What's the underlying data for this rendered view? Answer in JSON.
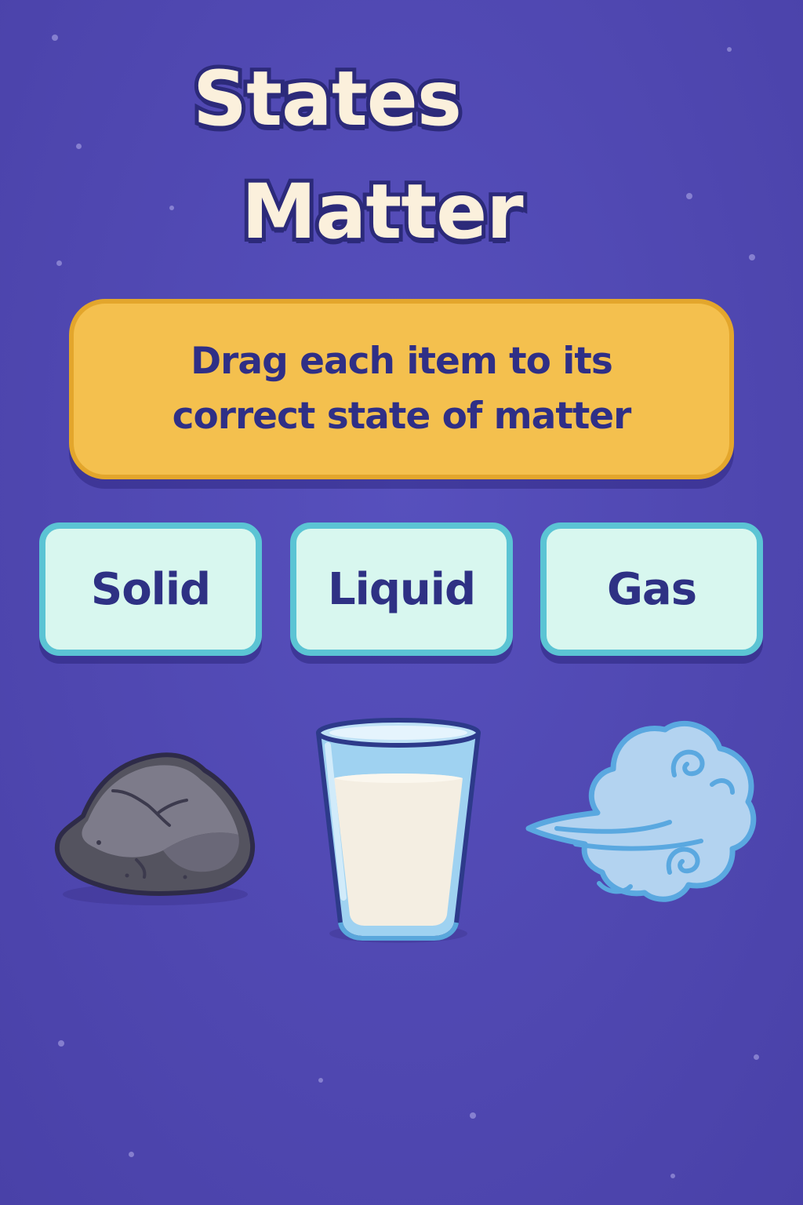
{
  "title": {
    "line1": "States",
    "line2": "Matter"
  },
  "instruction": {
    "line1": "Drag each item to its",
    "line2": "correct state of matter"
  },
  "states": [
    {
      "label": "Solid"
    },
    {
      "label": "Liquid"
    },
    {
      "label": "Gas"
    }
  ],
  "items": [
    {
      "icon": "rock-icon"
    },
    {
      "icon": "glass-of-milk-icon"
    },
    {
      "icon": "wind-cloud-icon"
    }
  ],
  "colors": {
    "background": "#5149b3",
    "title_fill": "#fbf0dc",
    "title_outline": "#2c2a7a",
    "instruction_fill": "#f4c04e",
    "state_box_fill": "#d8f7ef",
    "state_box_border": "#5bc4d4",
    "label_text": "#2e3184"
  }
}
